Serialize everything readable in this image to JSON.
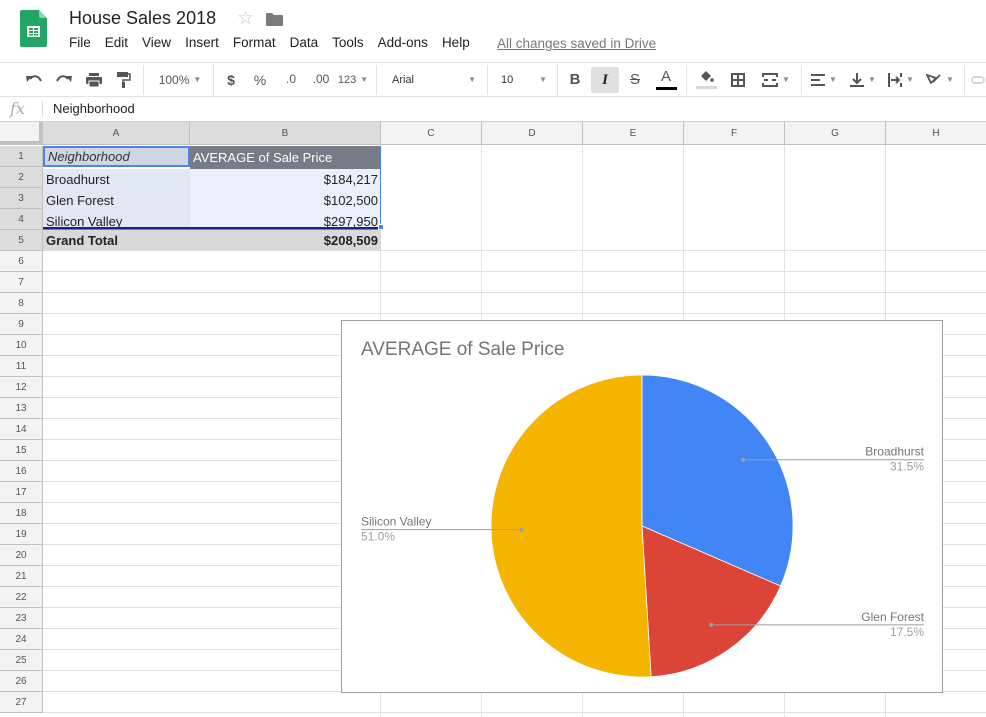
{
  "header": {
    "title": "House Sales 2018",
    "save_status": "All changes saved in Drive",
    "menu": [
      "File",
      "Edit",
      "View",
      "Insert",
      "Format",
      "Data",
      "Tools",
      "Add-ons",
      "Help"
    ]
  },
  "toolbar": {
    "zoom": "100%",
    "currency": "$",
    "percent": "%",
    "decrease_decimal": ".0",
    "increase_decimal": ".00",
    "more_formats": "123",
    "font": "Arial",
    "font_size": "10",
    "bold": "B",
    "italic": "I",
    "strikethrough": "S",
    "text_color_label": "A",
    "text_color": "#000000",
    "italic_active": true
  },
  "formula_bar": {
    "fx": "fx",
    "value": "Neighborhood"
  },
  "sheet": {
    "columns": [
      "A",
      "B",
      "C",
      "D",
      "E",
      "F",
      "G",
      "H"
    ],
    "rows": [
      "1",
      "2",
      "3",
      "4",
      "5",
      "6",
      "7",
      "8",
      "9",
      "10",
      "11",
      "12",
      "13",
      "14",
      "15",
      "16",
      "17",
      "18",
      "19",
      "20",
      "21",
      "22",
      "23",
      "24",
      "25",
      "26",
      "27"
    ],
    "pivot": {
      "header": [
        "Neighborhood",
        "AVERAGE of Sale Price"
      ],
      "rows": [
        [
          "Broadhurst",
          "$184,217"
        ],
        [
          "Glen Forest",
          "$102,500"
        ],
        [
          "Silicon Valley",
          "$297,950"
        ]
      ],
      "total": [
        "Grand Total",
        "$208,509"
      ]
    }
  },
  "chart_data": {
    "type": "pie",
    "title": "AVERAGE of Sale Price",
    "categories": [
      "Broadhurst",
      "Glen Forest",
      "Silicon Valley"
    ],
    "values": [
      184217,
      102500,
      297950
    ],
    "percent_labels": [
      "31.5%",
      "17.5%",
      "51.0%"
    ],
    "colors": [
      "#4285f4",
      "#db4437",
      "#f4b400"
    ],
    "legend": "labeled"
  }
}
